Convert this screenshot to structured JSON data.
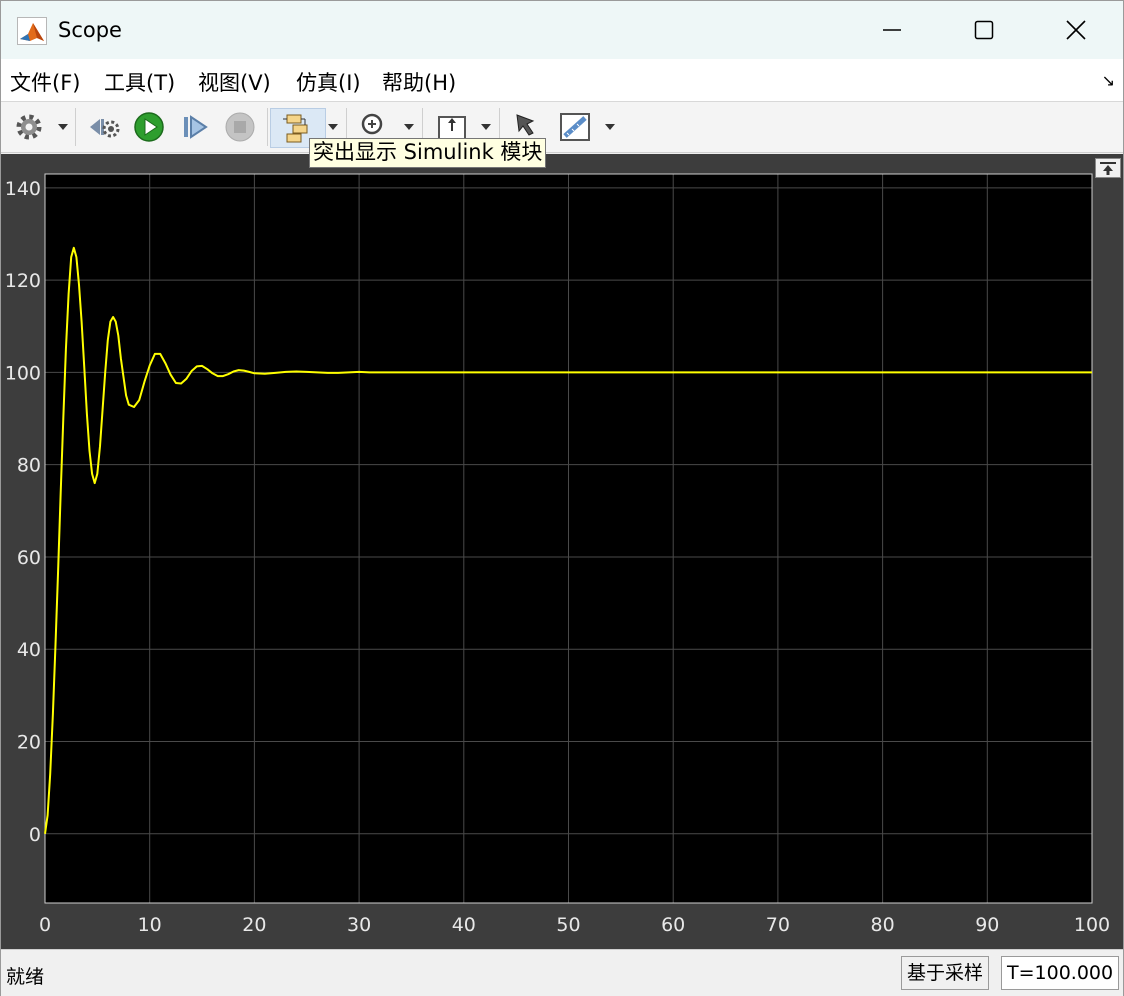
{
  "window": {
    "title": "Scope",
    "minimize_glyph": "—",
    "close_glyph": "✕"
  },
  "menu": {
    "items": [
      "文件(F)",
      "工具(T)",
      "视图(V)",
      "仿真(I)",
      "帮助(H)"
    ],
    "dock_arrow": "↘"
  },
  "toolbar": {
    "tooltip": "突出显示 Simulink 模块",
    "icons": [
      "gear-icon",
      "step-back-icon",
      "run-icon",
      "step-forward-icon",
      "stop-icon",
      "highlight-block-icon",
      "zoom-icon",
      "scale-axes-icon",
      "cursor-icon",
      "measurement-icon"
    ]
  },
  "status": {
    "left": "就绪",
    "mode": "基于采样",
    "time": "T=100.000"
  },
  "chart_data": {
    "type": "line",
    "title": "",
    "xlabel": "",
    "ylabel": "",
    "xlim": [
      0,
      100
    ],
    "ylim": [
      -15,
      143
    ],
    "xticks": [
      0,
      10,
      20,
      30,
      40,
      50,
      60,
      70,
      80,
      90,
      100
    ],
    "yticks": [
      0,
      20,
      40,
      60,
      80,
      100,
      120,
      140
    ],
    "grid": true,
    "background": "#000000",
    "series": [
      {
        "color": "#ffff00",
        "x": [
          0,
          0.25,
          0.5,
          0.75,
          1,
          1.25,
          1.5,
          1.75,
          2,
          2.25,
          2.5,
          2.75,
          3,
          3.25,
          3.5,
          3.75,
          4,
          4.25,
          4.5,
          4.75,
          5,
          5.25,
          5.5,
          5.75,
          6,
          6.25,
          6.5,
          6.75,
          7,
          7.25,
          7.5,
          7.75,
          8,
          8.5,
          9,
          9.5,
          10,
          10.5,
          11,
          11.5,
          12,
          12.5,
          13,
          13.5,
          14,
          14.5,
          15,
          15.5,
          16,
          16.5,
          17,
          17.5,
          18,
          18.5,
          19,
          19.5,
          20,
          21,
          22,
          23,
          24,
          25,
          26,
          27,
          28,
          29,
          30,
          31,
          32,
          33,
          34,
          36,
          38,
          40,
          45,
          50,
          60,
          70,
          80,
          90,
          100
        ],
        "y": [
          0,
          4,
          13,
          26,
          41,
          57,
          74,
          90,
          105,
          117,
          125,
          127,
          125,
          119,
          111,
          101,
          91,
          83,
          78,
          76,
          78,
          84,
          92,
          100,
          107,
          111,
          112,
          111,
          108,
          103,
          99,
          95,
          93,
          92.5,
          94,
          98,
          101.5,
          104,
          104,
          102,
          99.5,
          97.7,
          97.6,
          98.6,
          100.3,
          101.3,
          101.4,
          100.7,
          99.8,
          99.2,
          99.2,
          99.6,
          100.2,
          100.5,
          100.4,
          100.1,
          99.8,
          99.7,
          99.9,
          100.1,
          100.2,
          100.1,
          100,
          99.9,
          99.9,
          100,
          100.1,
          100,
          100,
          100,
          100,
          100,
          100,
          100,
          100,
          100,
          100,
          100,
          100,
          100,
          100
        ]
      }
    ]
  }
}
